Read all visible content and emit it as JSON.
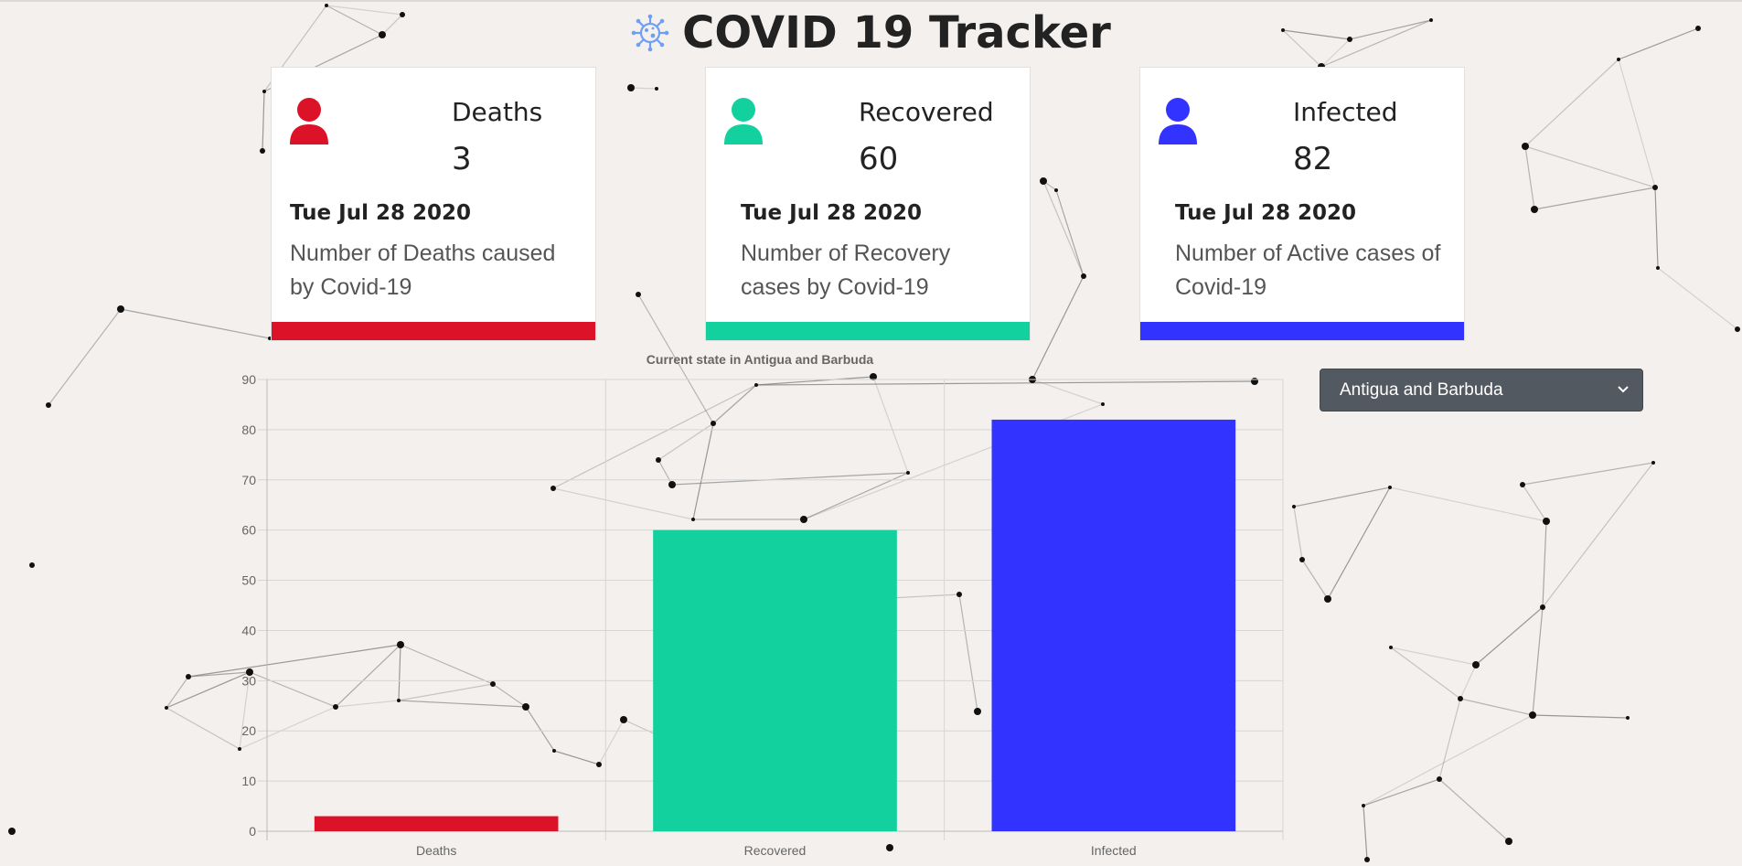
{
  "app": {
    "title": "COVID 19 Tracker",
    "virus_icon": "virus-icon"
  },
  "cards": [
    {
      "title": "Deaths",
      "value": "3",
      "date": "Tue Jul 28 2020",
      "description": "Number of Deaths caused by Covid-19",
      "color": "#dc1228",
      "icon": "person-icon"
    },
    {
      "title": "Recovered",
      "value": "60",
      "date": "Tue Jul 28 2020",
      "description": "Number of Recovery cases by Covid-19",
      "color": "#12d19e",
      "icon": "person-icon"
    },
    {
      "title": "Infected",
      "value": "82",
      "date": "Tue Jul 28 2020",
      "description": "Number of Active cases of Covid-19",
      "color": "#3333ff",
      "icon": "person-icon"
    }
  ],
  "country_select": {
    "value": "Antigua and Barbuda",
    "icon": "chevron-down-icon"
  },
  "chart_data": {
    "type": "bar",
    "title": "Current state in Antigua and Barbuda",
    "categories": [
      "Deaths",
      "Recovered",
      "Infected"
    ],
    "values": [
      3,
      60,
      82
    ],
    "colors": [
      "#dc1228",
      "#12d19e",
      "#3333ff"
    ],
    "ylim": [
      0,
      90
    ],
    "yticks": [
      "0",
      "10",
      "20",
      "30",
      "40",
      "50",
      "60",
      "70",
      "80",
      "90"
    ],
    "grid": true,
    "legend": "none"
  }
}
